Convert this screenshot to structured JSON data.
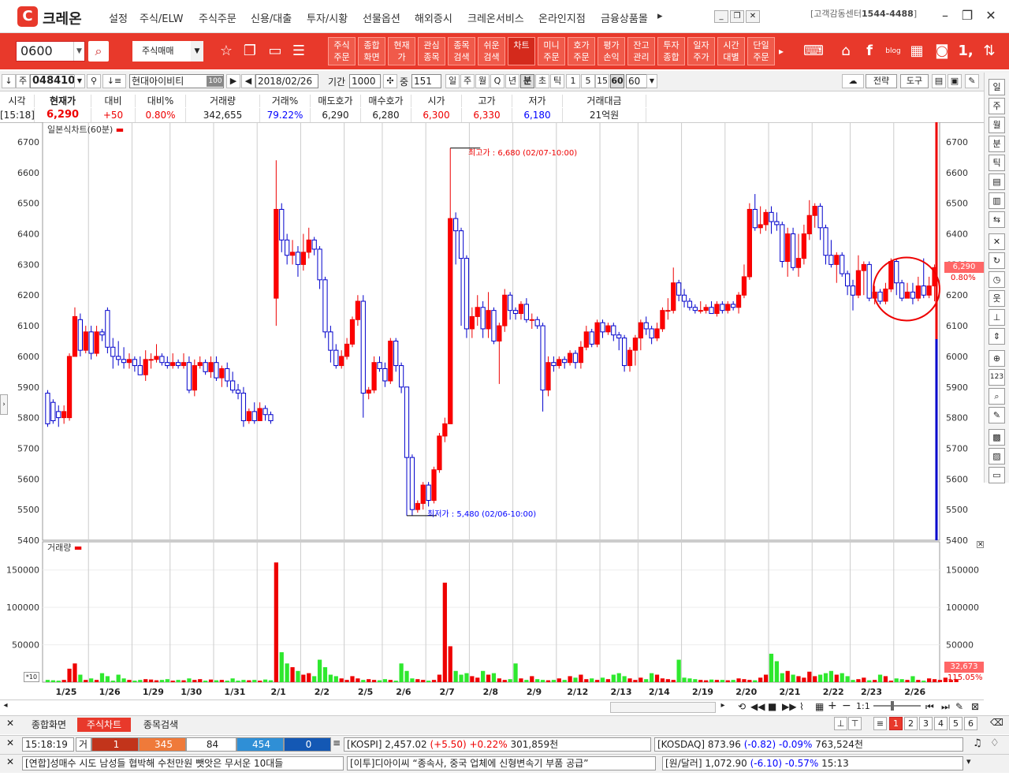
{
  "app": {
    "brand_letter": "C",
    "brand": "크레온",
    "menus": [
      "설정",
      "주식/ELW",
      "주식주문",
      "신용/대출",
      "투자/시황",
      "선물옵션",
      "해외증시",
      "크레온서비스",
      "온라인지점",
      "금융상품몰"
    ],
    "more": "▸",
    "helpdesk_label": "[고객감동센터",
    "helpdesk_phone": "1544-4488",
    "helpdesk_close": "]"
  },
  "toolbar": {
    "screen_code": "0600",
    "trade_mode": "주식매매",
    "quick": [
      "주식\n주문",
      "종합\n화면",
      "현재\n가",
      "관심\n종목",
      "종목\n검색",
      "쉬운\n검색",
      "차트",
      "미니\n주문",
      "호가\n주문",
      "평가\n손익",
      "잔고\n관리",
      "투자\n종합",
      "일자\n주가",
      "시간\n대별",
      "단일\n주문"
    ]
  },
  "chart_toolbar": {
    "market": "주",
    "code": "048410",
    "name": "현대아이비티",
    "pct_badge": "100",
    "date": "2018/02/26",
    "period_label": "기간",
    "period": "1000",
    "zoom_label": "중",
    "zoom": "151",
    "units": [
      "일",
      "주",
      "월",
      "Q",
      "년",
      "분",
      "초",
      "틱",
      "1",
      "5",
      "15",
      "60"
    ],
    "unit_value": "60",
    "strategy": "전략",
    "tools": "도구"
  },
  "quote": {
    "headers": [
      "시각",
      "현재가",
      "대비",
      "대비%",
      "거래량",
      "거래%",
      "매도호가",
      "매수호가",
      "시가",
      "고가",
      "저가",
      "거래대금"
    ],
    "values": [
      "[15:18]",
      "6,290",
      "+50",
      "0.80%",
      "342,655",
      "79.22%",
      "6,290",
      "6,280",
      "6,300",
      "6,330",
      "6,180",
      "21억원"
    ]
  },
  "chart": {
    "title": "일본식차트(60분)",
    "vol_title": "거래량",
    "high_note": "최고가 : 6,680 (02/07-10:00)",
    "low_note": "최저가 : 5,480 (02/06-10:00)",
    "last_price": "6,290",
    "last_pct": "0.80%",
    "last_vol": "32,673",
    "last_vol_pct": "115.05%",
    "scale": "*10",
    "scale_ratio": "1:1"
  },
  "chart_data": {
    "type": "candlestick",
    "ylim": [
      5400,
      6700
    ],
    "y_ticks": [
      5400,
      5500,
      5600,
      5700,
      5800,
      5900,
      6000,
      6100,
      6200,
      6300,
      6400,
      6500,
      6600,
      6700
    ],
    "vol_ticks": [
      50000,
      100000,
      150000
    ],
    "dates": [
      "1/25",
      "1/26",
      "1/29",
      "1/30",
      "1/31",
      "2/1",
      "2/2",
      "2/5",
      "2/6",
      "2/7",
      "2/8",
      "2/9",
      "2/12",
      "2/13",
      "2/14",
      "2/19",
      "2/20",
      "2/21",
      "2/22",
      "2/23",
      "2/26"
    ],
    "candles": [
      [
        5880,
        5780,
        5890,
        5770
      ],
      [
        5850,
        5790,
        5860,
        5780
      ],
      [
        5820,
        5800,
        5840,
        5770
      ],
      [
        5800,
        5820,
        5840,
        5780
      ],
      [
        5800,
        6000,
        6010,
        5790
      ],
      [
        6000,
        6130,
        6160,
        6000
      ],
      [
        6120,
        6020,
        6140,
        6000
      ],
      [
        6020,
        6080,
        6100,
        6010
      ],
      [
        6080,
        6010,
        6100,
        5990
      ],
      [
        6010,
        6080,
        6100,
        6000
      ],
      [
        6080,
        6070,
        6090,
        6050
      ],
      [
        6150,
        6030,
        6160,
        6010
      ],
      [
        6030,
        6000,
        6060,
        5960
      ],
      [
        6000,
        5990,
        6050,
        5970
      ],
      [
        5990,
        5980,
        6030,
        5960
      ],
      [
        5980,
        5990,
        6010,
        5960
      ],
      [
        5990,
        5970,
        6000,
        5950
      ],
      [
        5970,
        5940,
        6000,
        5940
      ],
      [
        5940,
        5990,
        6020,
        5920
      ],
      [
        5990,
        5990,
        6010,
        5960
      ],
      [
        5990,
        6000,
        6040,
        5980
      ],
      [
        6000,
        5980,
        6010,
        5970
      ],
      [
        5980,
        5970,
        6000,
        5960
      ],
      [
        5970,
        5980,
        6010,
        5960
      ],
      [
        5980,
        5970,
        5990,
        5960
      ],
      [
        5970,
        5980,
        6010,
        5960
      ],
      [
        5980,
        5890,
        6000,
        5880
      ],
      [
        5890,
        5970,
        5990,
        5870
      ],
      [
        5970,
        5980,
        6000,
        5960
      ],
      [
        5980,
        5950,
        5990,
        5940
      ],
      [
        5950,
        5980,
        6000,
        5930
      ],
      [
        5980,
        5930,
        6000,
        5920
      ],
      [
        5930,
        5960,
        5970,
        5900
      ],
      [
        5960,
        5920,
        5980,
        5900
      ],
      [
        5920,
        5890,
        5950,
        5880
      ],
      [
        5890,
        5880,
        5910,
        5860
      ],
      [
        5880,
        5790,
        5900,
        5770
      ],
      [
        5790,
        5820,
        5830,
        5780
      ],
      [
        5820,
        5790,
        5850,
        5780
      ],
      [
        5790,
        5830,
        5850,
        5790
      ],
      [
        5830,
        5810,
        5840,
        5790
      ],
      [
        5810,
        5790,
        5820,
        5780
      ],
      [
        6190,
        6480,
        6640,
        6100
      ],
      [
        6480,
        6380,
        6500,
        6340
      ],
      [
        6380,
        6330,
        6400,
        6300
      ],
      [
        6330,
        6340,
        6380,
        6300
      ],
      [
        6340,
        6300,
        6360,
        6260
      ],
      [
        6300,
        6340,
        6400,
        6280
      ],
      [
        6340,
        6380,
        6420,
        6320
      ],
      [
        6380,
        6350,
        6390,
        6330
      ],
      [
        6350,
        6250,
        6360,
        6220
      ],
      [
        6250,
        6080,
        6260,
        6060
      ],
      [
        6080,
        6020,
        6100,
        5980
      ],
      [
        6020,
        5970,
        6040,
        5960
      ],
      [
        5970,
        6000,
        6020,
        5960
      ],
      [
        6000,
        6040,
        6060,
        5990
      ],
      [
        6040,
        6120,
        6130,
        6030
      ],
      [
        6120,
        6180,
        6200,
        6100
      ],
      [
        6180,
        5880,
        6200,
        5800
      ],
      [
        5880,
        5890,
        5900,
        5860
      ],
      [
        5890,
        5980,
        6000,
        5880
      ],
      [
        5980,
        5960,
        6000,
        5950
      ],
      [
        5960,
        5920,
        5980,
        5900
      ],
      [
        5920,
        6050,
        6060,
        5910
      ],
      [
        6050,
        5970,
        6060,
        5950
      ],
      [
        5970,
        5900,
        5980,
        5880
      ],
      [
        5900,
        5670,
        5700,
        5480
      ],
      [
        5670,
        5500,
        5680,
        5480
      ],
      [
        5500,
        5520,
        5530,
        5490
      ],
      [
        5520,
        5580,
        5590,
        5500
      ],
      [
        5580,
        5530,
        5590,
        5510
      ],
      [
        5530,
        5630,
        5640,
        5520
      ],
      [
        5630,
        5740,
        5750,
        5620
      ],
      [
        5740,
        5780,
        5800,
        5720
      ],
      [
        5780,
        6450,
        6680,
        5800
      ],
      [
        6450,
        6410,
        6470,
        6300
      ],
      [
        6410,
        6320,
        6420,
        6100
      ],
      [
        6320,
        6090,
        6330,
        6060
      ],
      [
        6090,
        6130,
        6160,
        6060
      ],
      [
        6130,
        6160,
        6200,
        6100
      ],
      [
        6160,
        6090,
        6180,
        6060
      ],
      [
        6090,
        6150,
        6210,
        6060
      ],
      [
        6150,
        6050,
        6160,
        6040
      ],
      [
        6050,
        6100,
        6110,
        5910
      ],
      [
        6100,
        6200,
        6220,
        6080
      ],
      [
        6200,
        6150,
        6210,
        6120
      ],
      [
        6150,
        6140,
        6160,
        6120
      ],
      [
        6140,
        6170,
        6180,
        6120
      ],
      [
        6170,
        6120,
        6190,
        6110
      ],
      [
        6120,
        6120,
        6140,
        6090
      ],
      [
        6120,
        6100,
        6130,
        6090
      ],
      [
        6100,
        5890,
        6110,
        5820
      ],
      [
        5890,
        5980,
        6000,
        5870
      ],
      [
        5980,
        5970,
        6000,
        5950
      ],
      [
        5970,
        5990,
        6000,
        5960
      ],
      [
        5990,
        5980,
        6000,
        5960
      ],
      [
        5980,
        6010,
        6020,
        5970
      ],
      [
        6010,
        5980,
        6020,
        5960
      ],
      [
        5980,
        6030,
        6050,
        5960
      ],
      [
        6030,
        6080,
        6100,
        6020
      ],
      [
        6080,
        6040,
        6090,
        6030
      ],
      [
        6040,
        6110,
        6120,
        6030
      ],
      [
        6110,
        6080,
        6120,
        6060
      ],
      [
        6080,
        6100,
        6110,
        6070
      ],
      [
        6100,
        6070,
        6110,
        6050
      ],
      [
        6070,
        6060,
        6080,
        6020
      ],
      [
        6060,
        5970,
        6070,
        5950
      ],
      [
        5970,
        6020,
        6030,
        5950
      ],
      [
        6020,
        6060,
        6070,
        5970
      ],
      [
        6060,
        6110,
        6120,
        6020
      ],
      [
        6110,
        6090,
        6130,
        6070
      ],
      [
        6090,
        6060,
        6100,
        6040
      ],
      [
        6060,
        6090,
        6110,
        6050
      ],
      [
        6090,
        6150,
        6160,
        6080
      ],
      [
        6150,
        6150,
        6190,
        6120
      ],
      [
        6150,
        6240,
        6290,
        6140
      ],
      [
        6240,
        6200,
        6250,
        6180
      ],
      [
        6200,
        6180,
        6220,
        6160
      ],
      [
        6180,
        6160,
        6190,
        6150
      ],
      [
        6160,
        6150,
        6170,
        6140
      ],
      [
        6150,
        6150,
        6180,
        6140
      ],
      [
        6150,
        6160,
        6170,
        6140
      ],
      [
        6160,
        6140,
        6180,
        6140
      ],
      [
        6140,
        6170,
        6180,
        6130
      ],
      [
        6170,
        6150,
        6180,
        6140
      ],
      [
        6150,
        6170,
        6180,
        6140
      ],
      [
        6170,
        6160,
        6180,
        6150
      ],
      [
        6160,
        6200,
        6210,
        6140
      ],
      [
        6200,
        6260,
        6300,
        6190
      ],
      [
        6260,
        6480,
        6500,
        6250
      ],
      [
        6480,
        6420,
        6530,
        6410
      ],
      [
        6420,
        6430,
        6490,
        6400
      ],
      [
        6430,
        6470,
        6480,
        6410
      ],
      [
        6470,
        6440,
        6490,
        6400
      ],
      [
        6440,
        6430,
        6470,
        6410
      ],
      [
        6430,
        6310,
        6440,
        6290
      ],
      [
        6310,
        6400,
        6420,
        6260
      ],
      [
        6400,
        6290,
        6420,
        6280
      ],
      [
        6290,
        6320,
        6400,
        6260
      ],
      [
        6320,
        6400,
        6430,
        6300
      ],
      [
        6400,
        6460,
        6510,
        6380
      ],
      [
        6460,
        6490,
        6500,
        6420
      ],
      [
        6490,
        6420,
        6500,
        6380
      ],
      [
        6420,
        6330,
        6430,
        6300
      ],
      [
        6330,
        6300,
        6380,
        6290
      ],
      [
        6300,
        6330,
        6340,
        6240
      ],
      [
        6330,
        6270,
        6340,
        6260
      ],
      [
        6270,
        6230,
        6280,
        6200
      ],
      [
        6230,
        6200,
        6250,
        6150
      ],
      [
        6200,
        6280,
        6330,
        6190
      ],
      [
        6280,
        6300,
        6310,
        6200
      ],
      [
        6300,
        6190,
        6310,
        6180
      ],
      [
        6190,
        6210,
        6230,
        6170
      ],
      [
        6210,
        6180,
        6220,
        6170
      ],
      [
        6180,
        6220,
        6240,
        6170
      ],
      [
        6220,
        6310,
        6320,
        6210
      ],
      [
        6310,
        6240,
        6320,
        6200
      ],
      [
        6240,
        6190,
        6250,
        6180
      ],
      [
        6190,
        6210,
        6240,
        6190
      ],
      [
        6210,
        6190,
        6240,
        6170
      ],
      [
        6190,
        6230,
        6260,
        6180
      ],
      [
        6230,
        6200,
        6320,
        6190
      ],
      [
        6200,
        6230,
        6260,
        6190
      ],
      [
        6230,
        6290,
        6300,
        6180
      ]
    ],
    "volumes": [
      3000,
      2500,
      2000,
      3000,
      18000,
      25000,
      10000,
      3000,
      5000,
      3000,
      12000,
      8000,
      2000,
      10000,
      5000,
      3000,
      2000,
      3000,
      4000,
      3500,
      2500,
      3000,
      4000,
      2000,
      3000,
      2500,
      5000,
      3000,
      4000,
      2000,
      3500,
      2500,
      3000,
      2000,
      5000,
      2000,
      3000,
      2500,
      3000,
      2000,
      3500,
      2500,
      160000,
      40000,
      25000,
      20000,
      15000,
      10000,
      12000,
      8000,
      30000,
      20000,
      10000,
      8000,
      5000,
      3000,
      8000,
      5000,
      3000,
      4000,
      3000,
      2500,
      4000,
      3000,
      2000,
      25000,
      15000,
      5000,
      4000,
      3000,
      2000,
      3000,
      10000,
      133000,
      48000,
      15000,
      10000,
      12000,
      8000,
      6000,
      15000,
      10000,
      12000,
      5000,
      3000,
      4000,
      25000,
      5000,
      3000,
      8000,
      4000,
      3000,
      2500,
      3000,
      5000,
      3000,
      8000,
      6000,
      10000,
      4000,
      5000,
      3000,
      6000,
      4000,
      10000,
      12000,
      8000,
      5000,
      3000,
      6000,
      4000,
      12000,
      10000,
      5000,
      4000,
      3000,
      30000,
      6000,
      5000,
      4000,
      3000,
      2500,
      3500,
      3000,
      3000,
      2500,
      3000,
      5000,
      4000,
      3000,
      2500,
      6000,
      10000,
      38000,
      28000,
      12000,
      15000,
      10000,
      8000,
      6000,
      14000,
      8000,
      10000,
      12000,
      15000,
      10000,
      12000,
      8000,
      3000,
      4000,
      6000,
      2500,
      3000,
      10000,
      8000,
      2000,
      5000,
      4000,
      3000,
      8000,
      3000,
      2000,
      5000,
      4000,
      3000,
      6000,
      3000,
      4000
    ]
  },
  "nav": {
    "reset": "⟲",
    "prev": "◂",
    "play": "◀◀",
    "stop": "■",
    "next": "▶▶",
    "add": "+",
    "sub": "−"
  },
  "tabs": [
    "종합화면",
    "주식차트",
    "종목검색"
  ],
  "pages": [
    "1",
    "2",
    "3",
    "4",
    "5",
    "6"
  ],
  "status": {
    "time": "15:18:19",
    "ind": "거",
    "b1": "1",
    "b2": "345",
    "b3": "84",
    "b4": "454",
    "b5": "0",
    "kospi": "[KOSPI] 2,457.02",
    "kospi_chg": "(+5.50)",
    "kospi_pct": "+0.22%",
    "kospi_vol": "301,859천",
    "kosdaq": "[KOSDAQ] 873.96",
    "kosdaq_chg": "(-0.82)",
    "kosdaq_pct": "-0.09%",
    "kosdaq_vol": "763,524천"
  },
  "news": {
    "n1": "[연합]성매수 시도 남성들 협박해 수천만원 뺏앗은 무서운 10대들",
    "n2": "[이투]디아이씨 “종속사, 중국 업체에 신형변속기 부품 공급”",
    "fx": "[원/달러] 1,072.90",
    "fx_chg": "(-6.10)",
    "fx_pct": "-0.57%",
    "fx_time": "15:13"
  }
}
